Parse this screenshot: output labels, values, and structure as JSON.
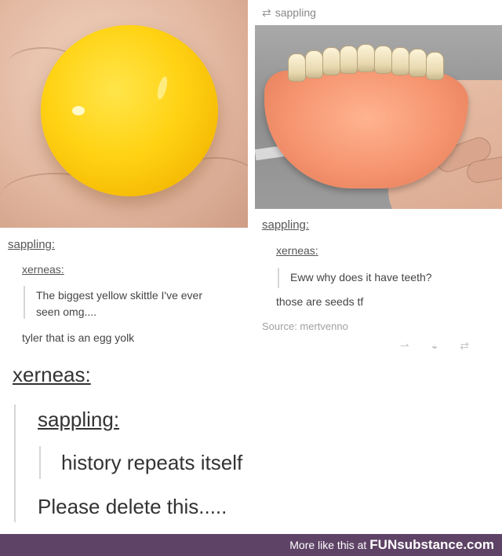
{
  "left_post": {
    "image": "egg-yolk-in-palm-photo",
    "blog": "sappling:",
    "reply_name": "xerneas:",
    "quoted_text_line1": "The biggest yellow skittle I've ever",
    "quoted_text_line2": "seen omg....",
    "reply_text": "tyler that is an egg yolk"
  },
  "right_post": {
    "reblog_icon": "reblog-icon",
    "reblog_label": "sappling",
    "image": "grapefruit-with-teeth-photo",
    "blog": "sappling:",
    "reply_name": "xerneas:",
    "quoted_text": "Eww why does it have teeth?",
    "reply_text": "those are seeds tf",
    "source": "Source: mertvenno"
  },
  "comment": {
    "blog": "xerneas:",
    "reply_name": "sappling:",
    "quoted_text": "history repeats itself",
    "reply_text": "Please delete this....."
  },
  "footer": {
    "more_like_this": "More like this at",
    "brand": "FUNsubstance.com"
  },
  "colors": {
    "brand_bar": "#5e4366",
    "yolk": "#ffd314"
  }
}
